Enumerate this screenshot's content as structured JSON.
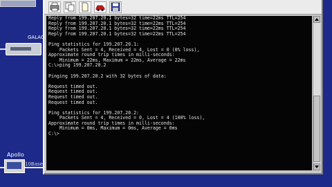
{
  "desktop": {
    "nodes": [
      {
        "label": "GALAC"
      },
      {
        "label": "Apollo",
        "link_label": "10BaseT"
      }
    ]
  },
  "toolbar": {
    "buttons": [
      {
        "icon": "printer-icon"
      },
      {
        "icon": "copy-icon"
      },
      {
        "icon": "page-icon"
      },
      {
        "icon": "car-icon"
      },
      {
        "icon": "save-icon"
      }
    ]
  },
  "console": {
    "lines": [
      "Reply from 199.207.20.1 bytes=32 time=22ms TTL=254",
      "Reply from 199.207.20.1 bytes=32 time=22ms TTL=254",
      "Reply from 199.207.20.1 bytes=32 time=22ms TTL=254",
      "Reply from 199.207.20.1 bytes=32 time=22ms TTL=254",
      "",
      "Ping statistics for 199.207.20.1:",
      "    Packets Sent = 4, Received = 4, Lost = 0 (0% loss),",
      "Approximate round trip times in milli-seconds:",
      "    Minimum = 22ms, Maximum = 22ms, Average = 22ms",
      "C:\\>ping 199.207.20.2",
      "",
      "Pinging 199.207.20.2 with 32 bytes of data:",
      "",
      "Request timed out.",
      "Request timed out.",
      "Request timed out.",
      "Request timed out.",
      "",
      "Ping statistics for 199.207.20.2:",
      "    Packets Sent = 4, Received = 0, Lost = 4 (100% loss),",
      "Approximate round trip times in milli-seconds:",
      "    Minimum = 0ms, Maximum = 0ms, Average = 0ms",
      "C:\\>"
    ]
  }
}
